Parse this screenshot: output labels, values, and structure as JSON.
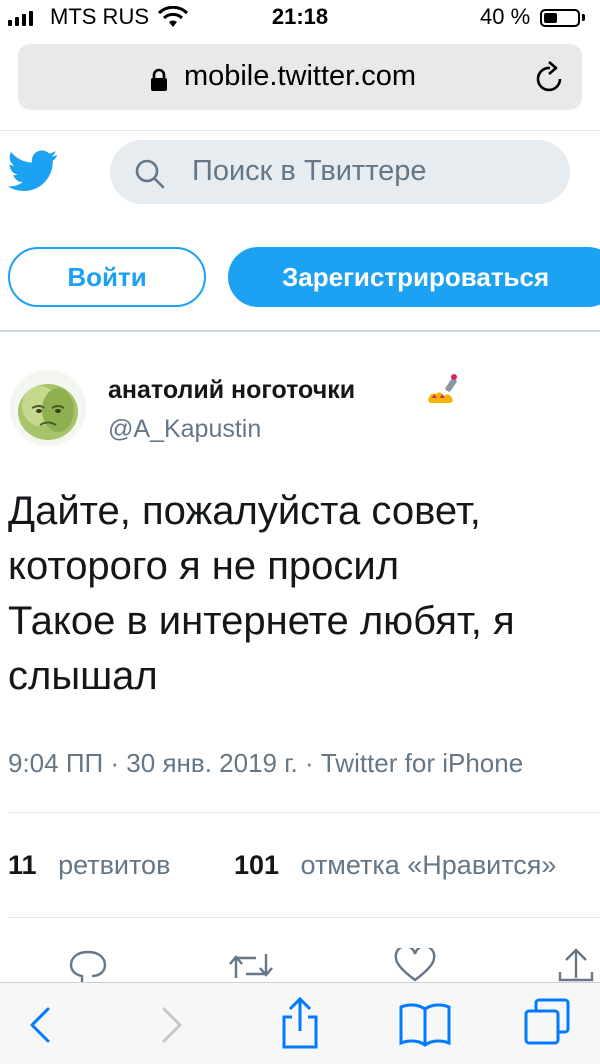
{
  "status_bar": {
    "carrier": "MTS RUS",
    "time": "21:18",
    "battery_percent": "40 %",
    "battery_level": 0.4
  },
  "browser": {
    "url": "mobile.twitter.com"
  },
  "header": {
    "search_placeholder": "Поиск в Твиттере",
    "login_label": "Войти",
    "signup_label": "Зарегистрироваться"
  },
  "tweet": {
    "author_name": "анатолий ноготочки",
    "author_handle": "@A_Kapustin",
    "text_lines": [
      "Дайте, пожалуйста совет,",
      "которого я не просил",
      "Такое в интернете любят, я",
      "слышал"
    ],
    "meta": "9:04 ПП · 30 янв. 2019 г. · Twitter for iPhone",
    "retweets_count": "11",
    "retweets_label": "ретвитов",
    "likes_count": "101",
    "likes_label": "отметка «Нравится»"
  },
  "colors": {
    "brand": "#1da1f2",
    "secondary_text": "#657786",
    "ios_blue": "#007aff"
  },
  "icons": {
    "action_bar": [
      "reply-icon",
      "retweet-icon",
      "like-icon",
      "share-icon"
    ],
    "safari_toolbar": [
      "back-icon",
      "forward-icon",
      "share-icon",
      "bookmarks-icon",
      "tabs-icon"
    ]
  }
}
